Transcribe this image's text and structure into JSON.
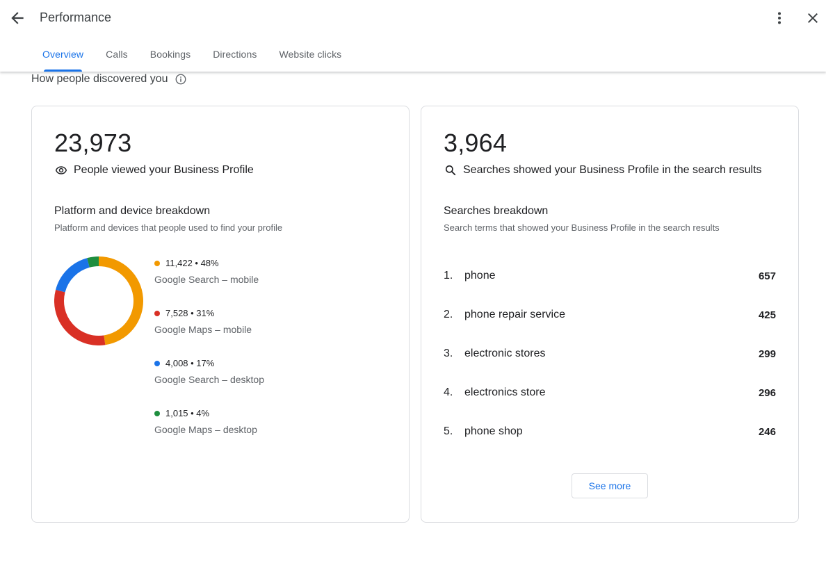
{
  "header": {
    "title": "Performance",
    "back_icon": "arrow-back-icon",
    "more_icon": "more-vert-icon",
    "close_icon": "close-icon"
  },
  "tabs": [
    {
      "label": "Overview",
      "active": true
    },
    {
      "label": "Calls",
      "active": false
    },
    {
      "label": "Bookings",
      "active": false
    },
    {
      "label": "Directions",
      "active": false
    },
    {
      "label": "Website clicks",
      "active": false
    }
  ],
  "section": {
    "heading": "How people discovered you",
    "info_icon": "info-icon"
  },
  "views_card": {
    "total": "23,973",
    "total_label": "People viewed your Business Profile",
    "breakdown_title": "Platform and device breakdown",
    "breakdown_subtitle": "Platform and devices that people used to find your profile",
    "items": [
      {
        "value": "11,422 • 48%",
        "label": "Google Search – mobile",
        "color": "#f29900"
      },
      {
        "value": "7,528 • 31%",
        "label": "Google Maps – mobile",
        "color": "#d93025"
      },
      {
        "value": "4,008 • 17%",
        "label": "Google Search – desktop",
        "color": "#1a73e8"
      },
      {
        "value": "1,015 • 4%",
        "label": "Google Maps – desktop",
        "color": "#1e8e3e"
      }
    ]
  },
  "chart_data": {
    "type": "pie",
    "categories": [
      "Google Search – mobile",
      "Google Maps – mobile",
      "Google Search – desktop",
      "Google Maps – desktop"
    ],
    "values": [
      11422,
      7528,
      4008,
      1015
    ],
    "percents": [
      48,
      31,
      17,
      4
    ],
    "colors": [
      "#f29900",
      "#d93025",
      "#1a73e8",
      "#1e8e3e"
    ],
    "style": "donut"
  },
  "searches_card": {
    "total": "3,964",
    "total_label": "Searches showed your Business Profile in the search results",
    "breakdown_title": "Searches breakdown",
    "breakdown_subtitle": "Search terms that showed your Business Profile in the search results",
    "terms": [
      {
        "rank": "1.",
        "term": "phone",
        "count": "657"
      },
      {
        "rank": "2.",
        "term": "phone repair service",
        "count": "425"
      },
      {
        "rank": "3.",
        "term": "electronic stores",
        "count": "299"
      },
      {
        "rank": "4.",
        "term": "electronics store",
        "count": "296"
      },
      {
        "rank": "5.",
        "term": "phone shop",
        "count": "246"
      }
    ],
    "see_more_label": "See more"
  }
}
